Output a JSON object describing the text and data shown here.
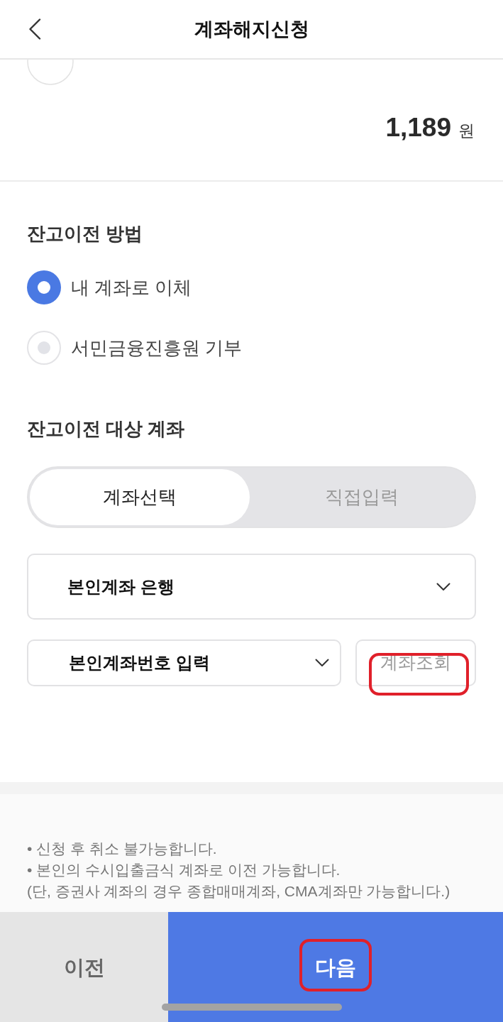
{
  "header": {
    "title": "계좌해지신청"
  },
  "balance": {
    "amount": "1,189",
    "unit": "원"
  },
  "transfer_method": {
    "title": "잔고이전 방법",
    "options": [
      {
        "label": "내 계좌로 이체",
        "selected": true
      },
      {
        "label": "서민금융진흥원 기부",
        "selected": false
      }
    ]
  },
  "target_account": {
    "title": "잔고이전 대상 계좌",
    "tabs": [
      {
        "label": "계좌선택",
        "selected": true
      },
      {
        "label": "직접입력",
        "selected": false
      }
    ],
    "bank_select": {
      "value": "본인계좌 은행"
    },
    "account_select": {
      "value": "본인계좌번호 입력"
    },
    "lookup_button": {
      "label": "계좌조회",
      "disabled": true,
      "circled": true
    }
  },
  "notes": [
    "• 신청 후 취소 불가능합니다.",
    "• 본인의 수시입출금식 계좌로 이전 가능합니다.",
    "(단, 증권사 계좌의 경우 종합매매계좌, CMA계좌만 가능합니다.)"
  ],
  "footer_buttons": [
    {
      "label": "이전",
      "kind": "secondary",
      "circled": false
    },
    {
      "label": "다음",
      "kind": "primary",
      "circled": true
    }
  ]
}
